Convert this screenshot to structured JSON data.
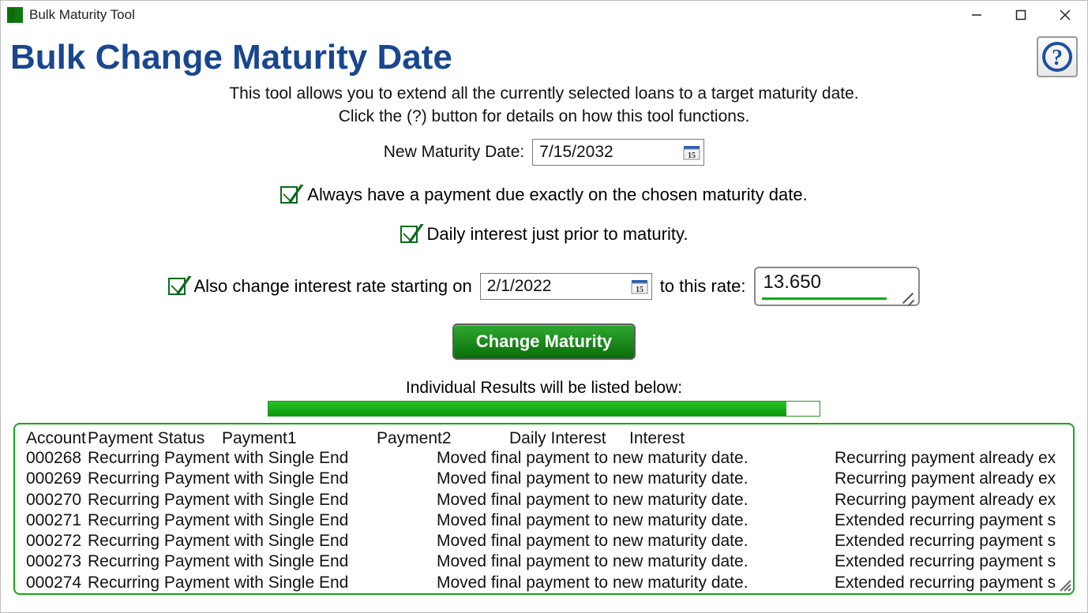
{
  "window": {
    "title": "Bulk Maturity Tool"
  },
  "heading": "Bulk Change Maturity Date",
  "intro_line1": "This tool allows you to extend all the currently selected loans to a target maturity date.",
  "intro_line2": "Click the (?) button for details on how this tool functions.",
  "maturity": {
    "label": "New Maturity Date:",
    "value": "7/15/2032"
  },
  "opts": {
    "payment_due_label": "Always have a payment due exactly on the chosen maturity date.",
    "daily_interest_label": "Daily interest just prior to maturity.",
    "change_rate_prefix": "Also change interest rate starting on",
    "change_rate_suffix": "to this rate:",
    "rate_date": "2/1/2022",
    "rate_value": "13.650"
  },
  "action_button": "Change Maturity",
  "results_label": "Individual Results will be listed below:",
  "progress_pct": 94,
  "columns": {
    "account": "Account",
    "payment_status": "Payment Status",
    "payment1": "Payment1",
    "payment2": "Payment2",
    "daily_interest": "Daily Interest",
    "interest": "Interest"
  },
  "rows": [
    {
      "account": "000268",
      "payment_status": "Recurring Payment with Single End",
      "payment2": "Moved final payment to new maturity date.",
      "interest": "Recurring payment already ex"
    },
    {
      "account": "000269",
      "payment_status": "Recurring Payment with Single End",
      "payment2": "Moved final payment to new maturity date.",
      "interest": "Recurring payment already ex"
    },
    {
      "account": "000270",
      "payment_status": "Recurring Payment with Single End",
      "payment2": "Moved final payment to new maturity date.",
      "interest": "Recurring payment already ex"
    },
    {
      "account": "000271",
      "payment_status": "Recurring Payment with Single End",
      "payment2": "Moved final payment to new maturity date.",
      "interest": "Extended recurring payment s"
    },
    {
      "account": "000272",
      "payment_status": "Recurring Payment with Single End",
      "payment2": "Moved final payment to new maturity date.",
      "interest": "Extended recurring payment s"
    },
    {
      "account": "000273",
      "payment_status": "Recurring Payment with Single End",
      "payment2": "Moved final payment to new maturity date.",
      "interest": "Extended recurring payment s"
    },
    {
      "account": "000274",
      "payment_status": "Recurring Payment with Single End",
      "payment2": "Moved final payment to new maturity date.",
      "interest": "Extended recurring payment s"
    }
  ]
}
